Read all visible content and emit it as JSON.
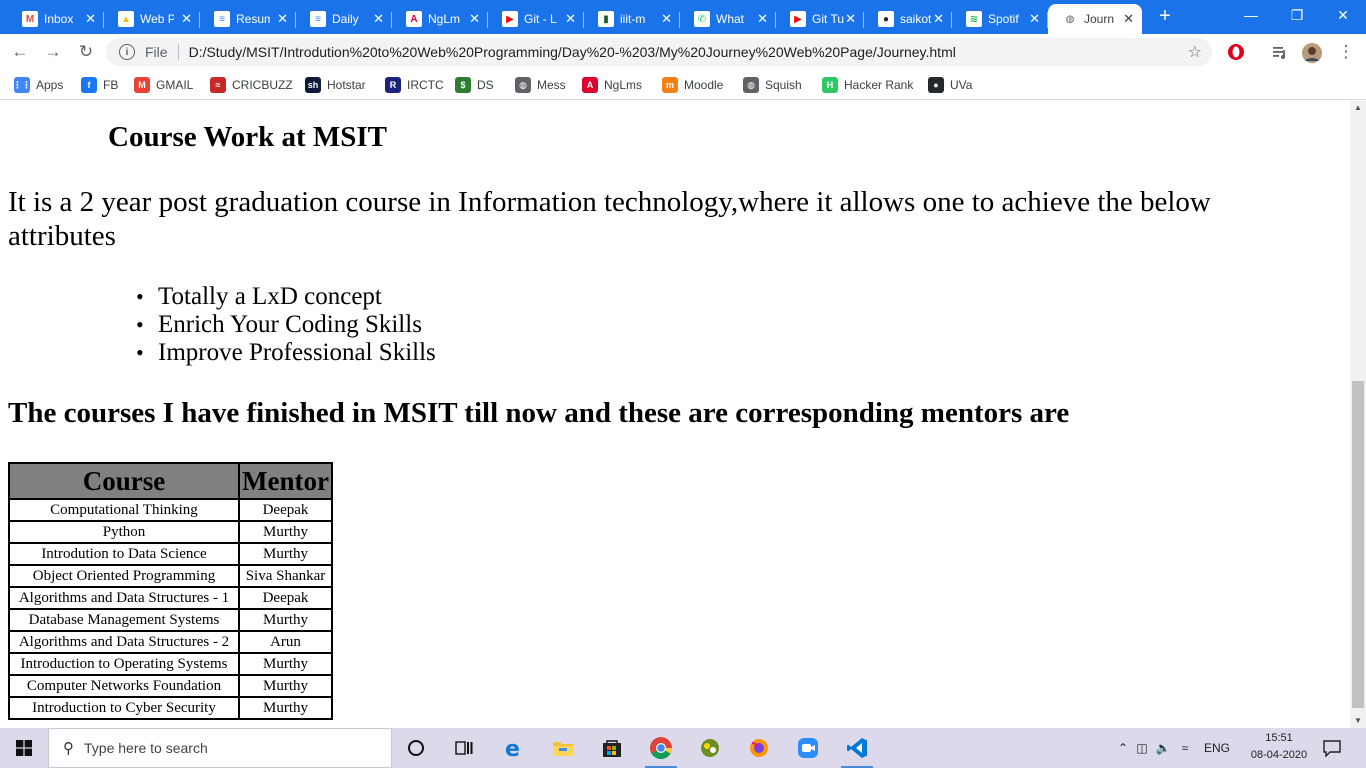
{
  "browser": {
    "tabs": [
      {
        "label": "Inbox",
        "icon": "gmail-icon",
        "color": "#ea4335",
        "glyph": "M"
      },
      {
        "label": "Web Pr",
        "icon": "google-drive-icon",
        "color": "#fbbc04",
        "glyph": "▲"
      },
      {
        "label": "Resum",
        "icon": "google-docs-icon",
        "color": "#4285f4",
        "glyph": "≡"
      },
      {
        "label": "Daily",
        "icon": "google-docs-icon",
        "color": "#4285f4",
        "glyph": "≡"
      },
      {
        "label": "NgLm",
        "icon": "angular-icon",
        "color": "#dd0031",
        "glyph": "A"
      },
      {
        "label": "Git - L",
        "icon": "youtube-icon",
        "color": "#ff0000",
        "glyph": "▶"
      },
      {
        "label": "iiit-m",
        "icon": "app-icon",
        "color": "#1b5e20",
        "glyph": "▮"
      },
      {
        "label": "What",
        "icon": "whatsapp-icon",
        "color": "#25d366",
        "glyph": "✆"
      },
      {
        "label": "Git Tu",
        "icon": "youtube-icon",
        "color": "#ff0000",
        "glyph": "▶"
      },
      {
        "label": "saikot",
        "icon": "github-icon",
        "color": "#24292e",
        "glyph": "●"
      },
      {
        "label": "Spotif",
        "icon": "spotify-icon",
        "color": "#1db954",
        "glyph": "≋"
      },
      {
        "label": "Journ",
        "icon": "globe-icon",
        "color": "#5f6368",
        "glyph": "◍",
        "active": true
      }
    ],
    "new_tab": "+",
    "window_controls": {
      "minimize": "—",
      "restore": "❐",
      "close": "✕"
    },
    "address": {
      "scheme": "File",
      "url": "D:/Study/MSIT/Introdution%20to%20Web%20Programming/Day%20-%203/My%20Journey%20Web%20Page/Journey.html"
    },
    "bookmarks": [
      {
        "label": "Apps",
        "icon": "apps-grid-icon",
        "color": "#4285f4",
        "glyph": "⋮⋮"
      },
      {
        "label": "FB",
        "icon": "facebook-icon",
        "color": "#1877f2",
        "glyph": "f"
      },
      {
        "label": "GMAIL",
        "icon": "gmail-icon",
        "color": "#ea4335",
        "glyph": "M"
      },
      {
        "label": "CRICBUZZ",
        "icon": "cricbuzz-icon",
        "color": "#c62828",
        "glyph": "≈"
      },
      {
        "label": "Hotstar",
        "icon": "hotstar-icon",
        "color": "#0c1b3a",
        "glyph": "sh"
      },
      {
        "label": "IRCTC",
        "icon": "irctc-icon",
        "color": "#1a237e",
        "glyph": "R"
      },
      {
        "label": "DS",
        "icon": "ds-icon",
        "color": "#2e7d32",
        "glyph": "$"
      },
      {
        "label": "Mess",
        "icon": "globe-icon",
        "color": "#5f6368",
        "glyph": "◍"
      },
      {
        "label": "NgLms",
        "icon": "angular-icon",
        "color": "#dd0031",
        "glyph": "A"
      },
      {
        "label": "Moodle",
        "icon": "moodle-icon",
        "color": "#f98012",
        "glyph": "m"
      },
      {
        "label": "Squish",
        "icon": "globe-icon",
        "color": "#5f6368",
        "glyph": "◍"
      },
      {
        "label": "Hacker Rank",
        "icon": "hackerrank-icon",
        "color": "#2ec866",
        "glyph": "H"
      },
      {
        "label": "UVa",
        "icon": "github-icon",
        "color": "#24292e",
        "glyph": "●"
      }
    ]
  },
  "page": {
    "heading": "Course Work at MSIT",
    "intro": "It is a 2 year post graduation course in Information technology,where it allows one to achieve the below attributes",
    "attributes": [
      "Totally a LxD concept",
      "Enrich Your Coding Skills",
      "Improve Professional Skills"
    ],
    "courses_heading": "The courses I have finished in MSIT till now and these are corresponding mentors are",
    "table": {
      "headers": [
        "Course",
        "Mentor"
      ],
      "header_bg": "#808080",
      "rows": [
        [
          "Computational Thinking",
          "Deepak"
        ],
        [
          "Python",
          "Murthy"
        ],
        [
          "Introdution to Data Science",
          "Murthy"
        ],
        [
          "Object Oriented Programming",
          "Siva Shankar"
        ],
        [
          "Algorithms and Data Structures - 1",
          "Deepak"
        ],
        [
          "Database Management Systems",
          "Murthy"
        ],
        [
          "Algorithms and Data Structures - 2",
          "Arun"
        ],
        [
          "Introduction to Operating Systems",
          "Murthy"
        ],
        [
          "Computer Networks Foundation",
          "Murthy"
        ],
        [
          "Introduction to Cyber Security",
          "Murthy"
        ]
      ]
    }
  },
  "taskbar": {
    "search_placeholder": "Type here to search",
    "language": "ENG",
    "time": "15:51",
    "date": "08-04-2020",
    "colors": {
      "accent": "#4a8bdc",
      "background": "#dcd9ea"
    }
  }
}
